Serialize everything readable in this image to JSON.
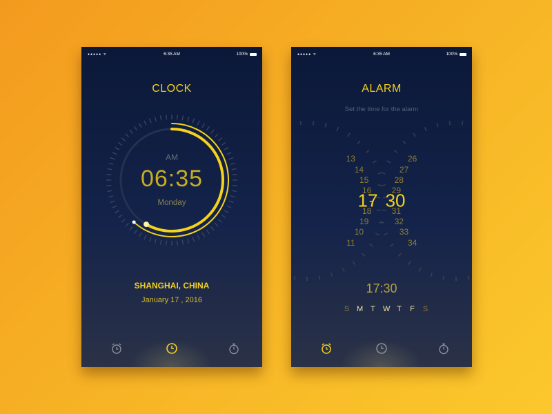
{
  "clock_screen": {
    "status": {
      "signal": "●●●●● ᯤ",
      "time": "6:35 AM",
      "battery": "100%"
    },
    "title": "CLOCK",
    "ampm": "AM",
    "time": "06:35",
    "day": "Monday",
    "city": "SHANGHAI, CHINA",
    "date": "January 17 , 2016",
    "nav": [
      {
        "icon": "alarm-clock-icon",
        "active": false
      },
      {
        "icon": "clock-icon",
        "active": true
      },
      {
        "icon": "stopwatch-icon",
        "active": false
      }
    ]
  },
  "alarm_screen": {
    "status": {
      "signal": "●●●●● ᯤ",
      "time": "6:35 AM",
      "battery": "100%"
    },
    "title": "ALARM",
    "subtitle": "Set the time for the alarm",
    "hours_before": [
      "13",
      "14",
      "15",
      "16"
    ],
    "hour_selected": "17",
    "hours_after": [
      "18",
      "19",
      "10",
      "11"
    ],
    "minutes_before": [
      "26",
      "27",
      "28",
      "29"
    ],
    "minute_selected": "30",
    "minutes_after": [
      "31",
      "32",
      "33",
      "34"
    ],
    "separator": "-",
    "alarm_time": "17:30",
    "weekdays": [
      {
        "label": "S",
        "active": false
      },
      {
        "label": "M",
        "active": true
      },
      {
        "label": "T",
        "active": true
      },
      {
        "label": "W",
        "active": true
      },
      {
        "label": "T",
        "active": true
      },
      {
        "label": "F",
        "active": true
      },
      {
        "label": "S",
        "active": false
      }
    ],
    "nav": [
      {
        "icon": "alarm-clock-icon",
        "active": true
      },
      {
        "icon": "clock-icon",
        "active": false
      },
      {
        "icon": "stopwatch-icon",
        "active": false
      }
    ]
  },
  "colors": {
    "accent": "#f5d21b",
    "panel": "#0b1838",
    "muted": "#8f7f2e"
  }
}
